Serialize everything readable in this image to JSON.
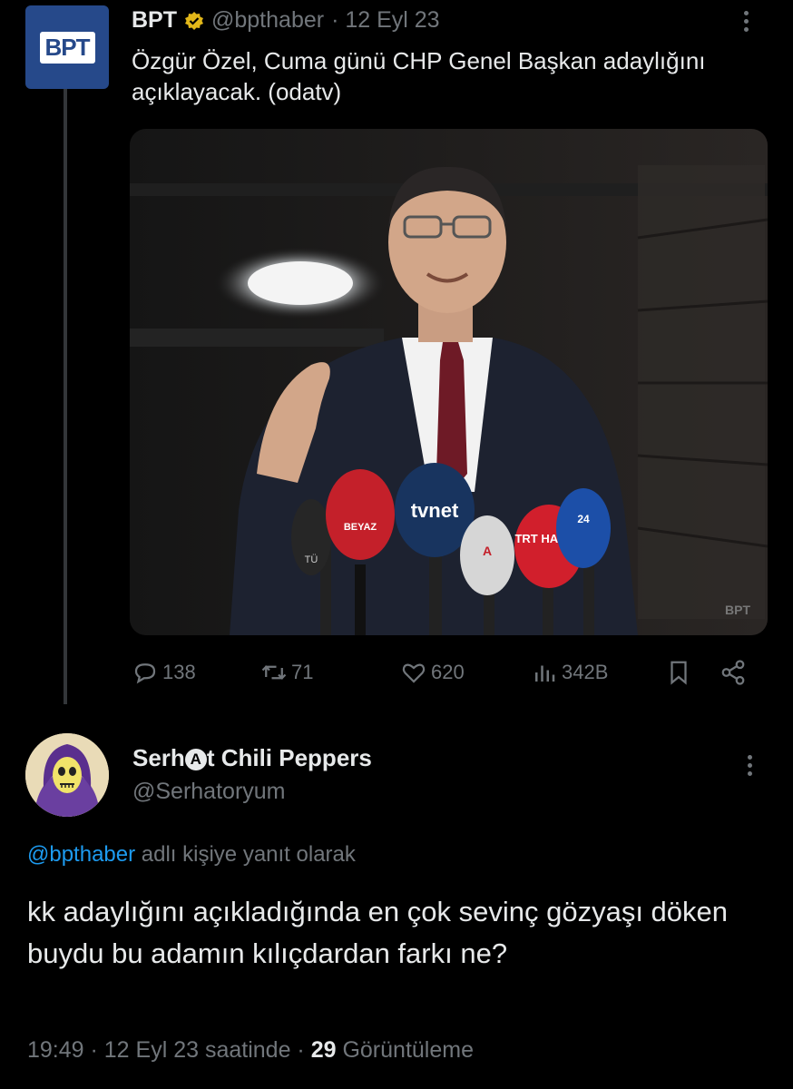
{
  "tweet": {
    "author_name": "BPT",
    "author_handle": "@bpthaber",
    "date": "· 12 Eyl 23",
    "logo_text": "BPT",
    "text": "Özgür Özel, Cuma günü CHP Genel Başkan adaylığını açıklayacak. (odatv)",
    "media": {
      "mic_labels": [
        "BEYAZ",
        "tvnet",
        "TRT HABER",
        "24",
        "TÜ",
        "A"
      ],
      "watermark": "BPT"
    },
    "actions": {
      "replies": "138",
      "retweets": "71",
      "likes": "620",
      "views": "342B"
    }
  },
  "reply": {
    "author_name_pre": "Serh",
    "author_name_circled": "A",
    "author_name_post": "t Chili Peppers",
    "author_handle": "@Serhatoryum",
    "replying_mention": "@bpthaber",
    "replying_suffix": " adlı kişiye yanıt olarak",
    "text": "kk adaylığını açıkladığında en çok sevinç gözyaşı döken buydu bu adamın kılıçdardan farkı ne?",
    "time": "19:49",
    "date_suffix": " · 12 Eyl 23 saatinde · ",
    "views_count": "29",
    "views_label": " Görüntüleme"
  },
  "colors": {
    "background": "#000000",
    "text": "#e7e9ea",
    "muted": "#71767b",
    "link": "#1d9bf0",
    "verified": "#e2b719",
    "bpt_brand": "#26498a"
  }
}
